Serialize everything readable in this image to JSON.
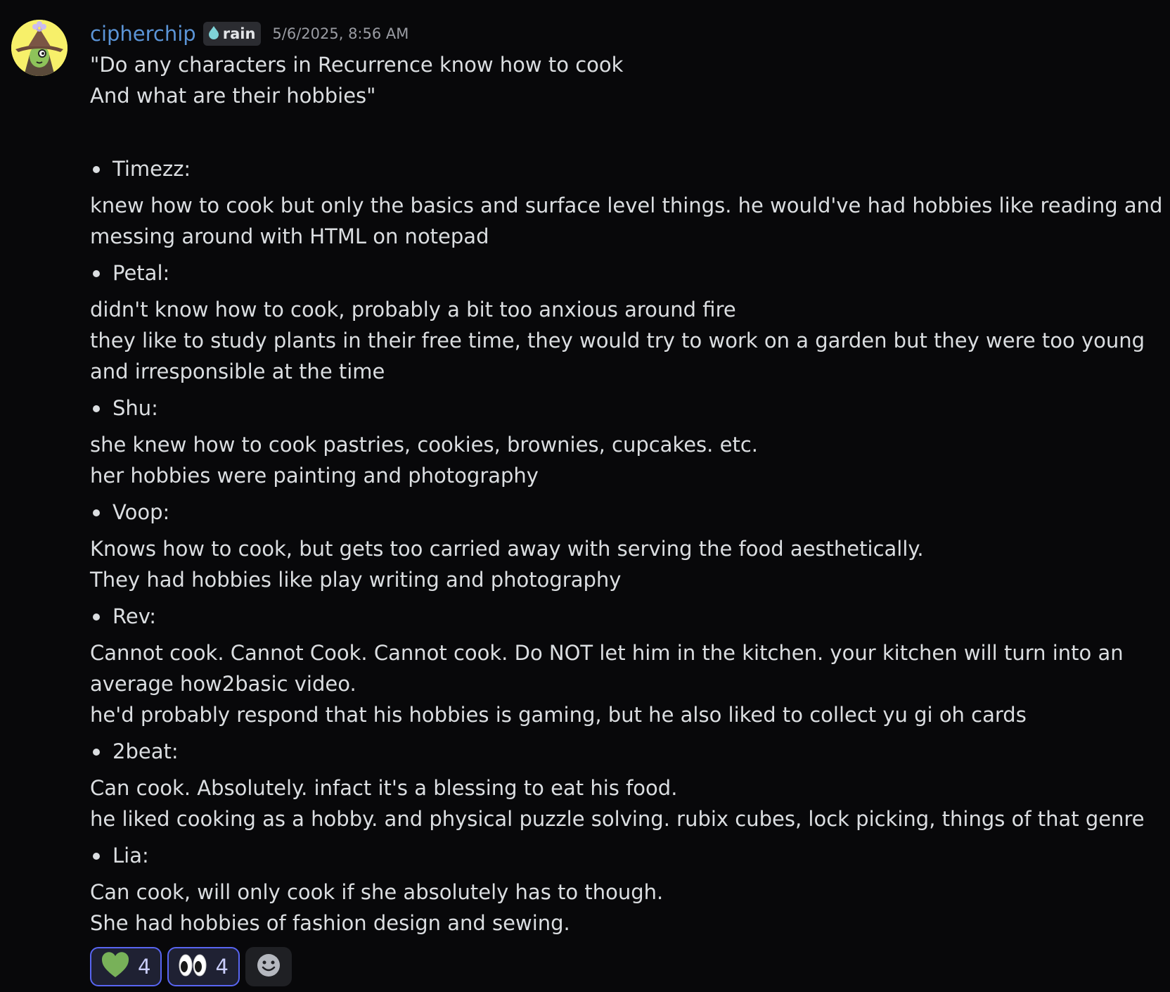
{
  "message": {
    "author": "cipherchip",
    "tag": "rain",
    "tag_icon": "water-drop-icon",
    "timestamp": "5/6/2025, 8:56 AM",
    "quote_lines": [
      "\"Do any characters in Recurrence know how to cook",
      "And what are their hobbies\""
    ],
    "characters": [
      {
        "name": "Timezz:",
        "lines": [
          "knew how to cook but only the basics and surface level things. he would've had hobbies like reading and messing around with HTML on notepad"
        ]
      },
      {
        "name": "Petal:",
        "lines": [
          "didn't know how to cook, probably a bit too anxious around fire",
          "they like to study plants in their free time, they would try to work on a garden but they were too young and irresponsible at the time"
        ]
      },
      {
        "name": "Shu:",
        "lines": [
          "she knew how to cook pastries, cookies, brownies, cupcakes. etc.",
          "her hobbies were painting and photography"
        ]
      },
      {
        "name": "Voop:",
        "lines": [
          "Knows how to cook, but gets too carried away with serving the food aesthetically.",
          "They had hobbies like play writing and photography"
        ]
      },
      {
        "name": "Rev:",
        "lines": [
          "Cannot cook. Cannot Cook. Cannot cook. Do NOT let him in the kitchen. your kitchen will turn into an average how2basic video.",
          "he'd probably respond that his hobbies is gaming, but he also liked to collect yu gi oh cards"
        ]
      },
      {
        "name": "2beat:",
        "lines": [
          "Can cook. Absolutely. infact it's a blessing to eat his food.",
          "he liked cooking as a hobby. and physical puzzle solving. rubix cubes, lock picking, things of that genre"
        ]
      },
      {
        "name": "Lia:",
        "lines": [
          "Can cook, will only cook if she absolutely has to though.",
          "She had hobbies of fashion design and sewing."
        ]
      }
    ]
  },
  "reactions": [
    {
      "icon": "green-heart-icon",
      "count": "4"
    },
    {
      "icon": "eyes-icon",
      "count": "4"
    }
  ],
  "add_reaction_icon": "smiley-add-reaction-icon",
  "colors": {
    "background": "#08080a",
    "username": "#5b94d6",
    "text": "#dbdee1",
    "reaction_border": "#5865f2",
    "reaction_bg": "#1f2133"
  }
}
